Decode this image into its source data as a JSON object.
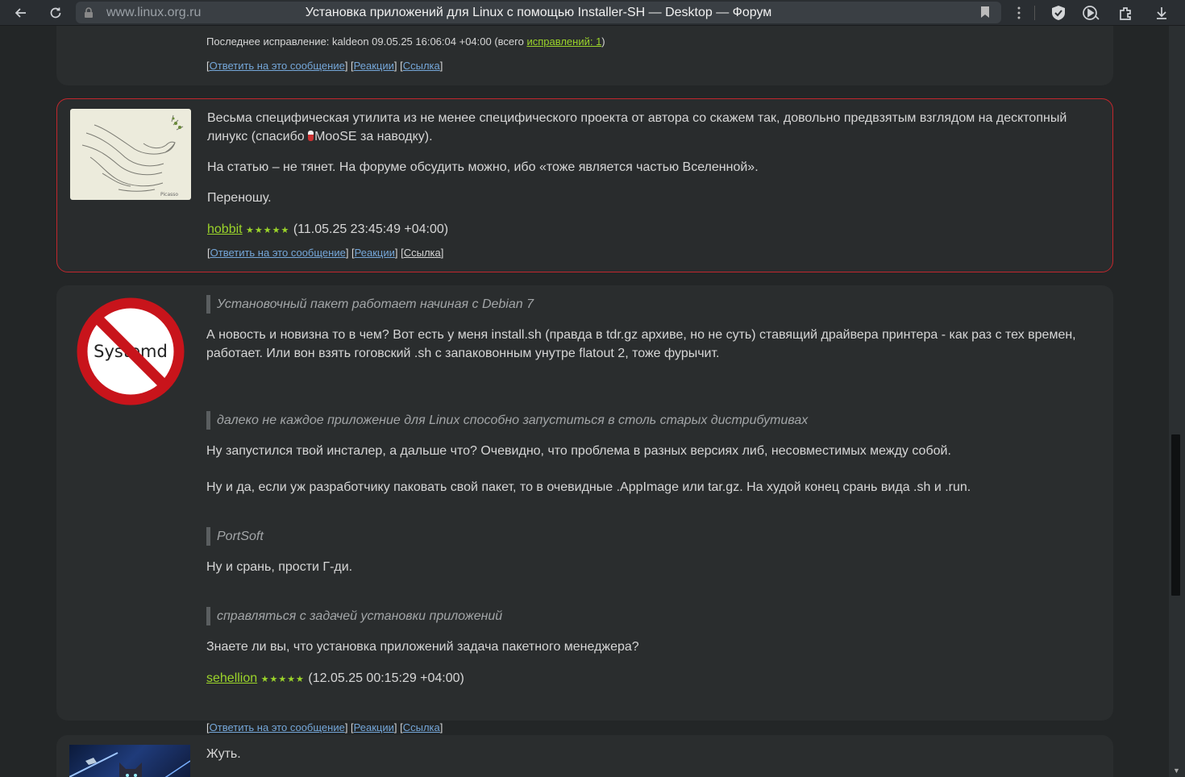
{
  "browser": {
    "url": "www.linux.org.ru",
    "title": "Установка приложений для Linux с помощью Installer-SH — Desktop — Форум"
  },
  "post0": {
    "last_edit_prefix": "Последнее исправление: kaldeon 09.05.25 16:06:04 +04:00 (всего ",
    "last_edit_link": "исправлений: 1",
    "last_edit_suffix": ")",
    "reply": "Ответить на это сообщение",
    "reactions": "Реакции",
    "link": "Ссылка"
  },
  "post1": {
    "p1_a": "Весьма специфическая утилита из не менее специфического проекта от автора со скажем так, довольно предвзятым взглядом на десктопный линукс (спасибо ",
    "p1_user": "MooSE",
    "p1_b": " за наводку).",
    "p2": "На статью – не тянет. На форуме обсудить можно, ибо «тоже является частью Вселенной».",
    "p3": "Переношу.",
    "author": "hobbit",
    "stars": "★★★★★",
    "date": "(11.05.25 23:45:49 +04:00)",
    "reply": "Ответить на это сообщение",
    "reactions": "Реакции",
    "link": "Ссылка"
  },
  "post2": {
    "avatar_text": "Systemd",
    "q1": "Установочный пакет работает начиная с Debian 7",
    "t1": "А новость и новизна то в чем? Вот есть у меня install.sh (правда в tdr.gz архиве, но не суть) ставящий драйвера принтера - как раз с тех времен, работает. Или вон взять гоговский .sh с запаковонным унутре flatout 2, тоже фурычит.",
    "q2": "далеко не каждое приложение для Linux способно запуститься в столь старых дистрибутивах",
    "t2": "Ну запустился твой инсталер, а дальше что? Очевидно, что проблема в разных версиях либ, несовместимых между собой.",
    "t3": "Ну и да, если уж разработчику паковать свой пакет, то в очевидные .AppImage или tar.gz. На худой конец срань вида .sh и .run.",
    "q3": "PortSoft",
    "t4": "Ну и срань, прости Г-ди.",
    "q4": "справляться с задачей установки приложений",
    "t5": "Знаете ли вы, что установка приложений задача пакетного менеджера?",
    "author": "sehellion",
    "stars": "★★★★★",
    "date": "(12.05.25 00:15:29 +04:00)",
    "reply": "Ответить на это сообщение",
    "reactions": "Реакции",
    "link": "Ссылка"
  },
  "post3": {
    "text": "Жуть."
  },
  "colors": {
    "background": "#232627",
    "card": "#2a2d2e",
    "highlight_border": "#c1272d",
    "author_link": "#9bd42a",
    "action_link": "#75a7d9"
  }
}
